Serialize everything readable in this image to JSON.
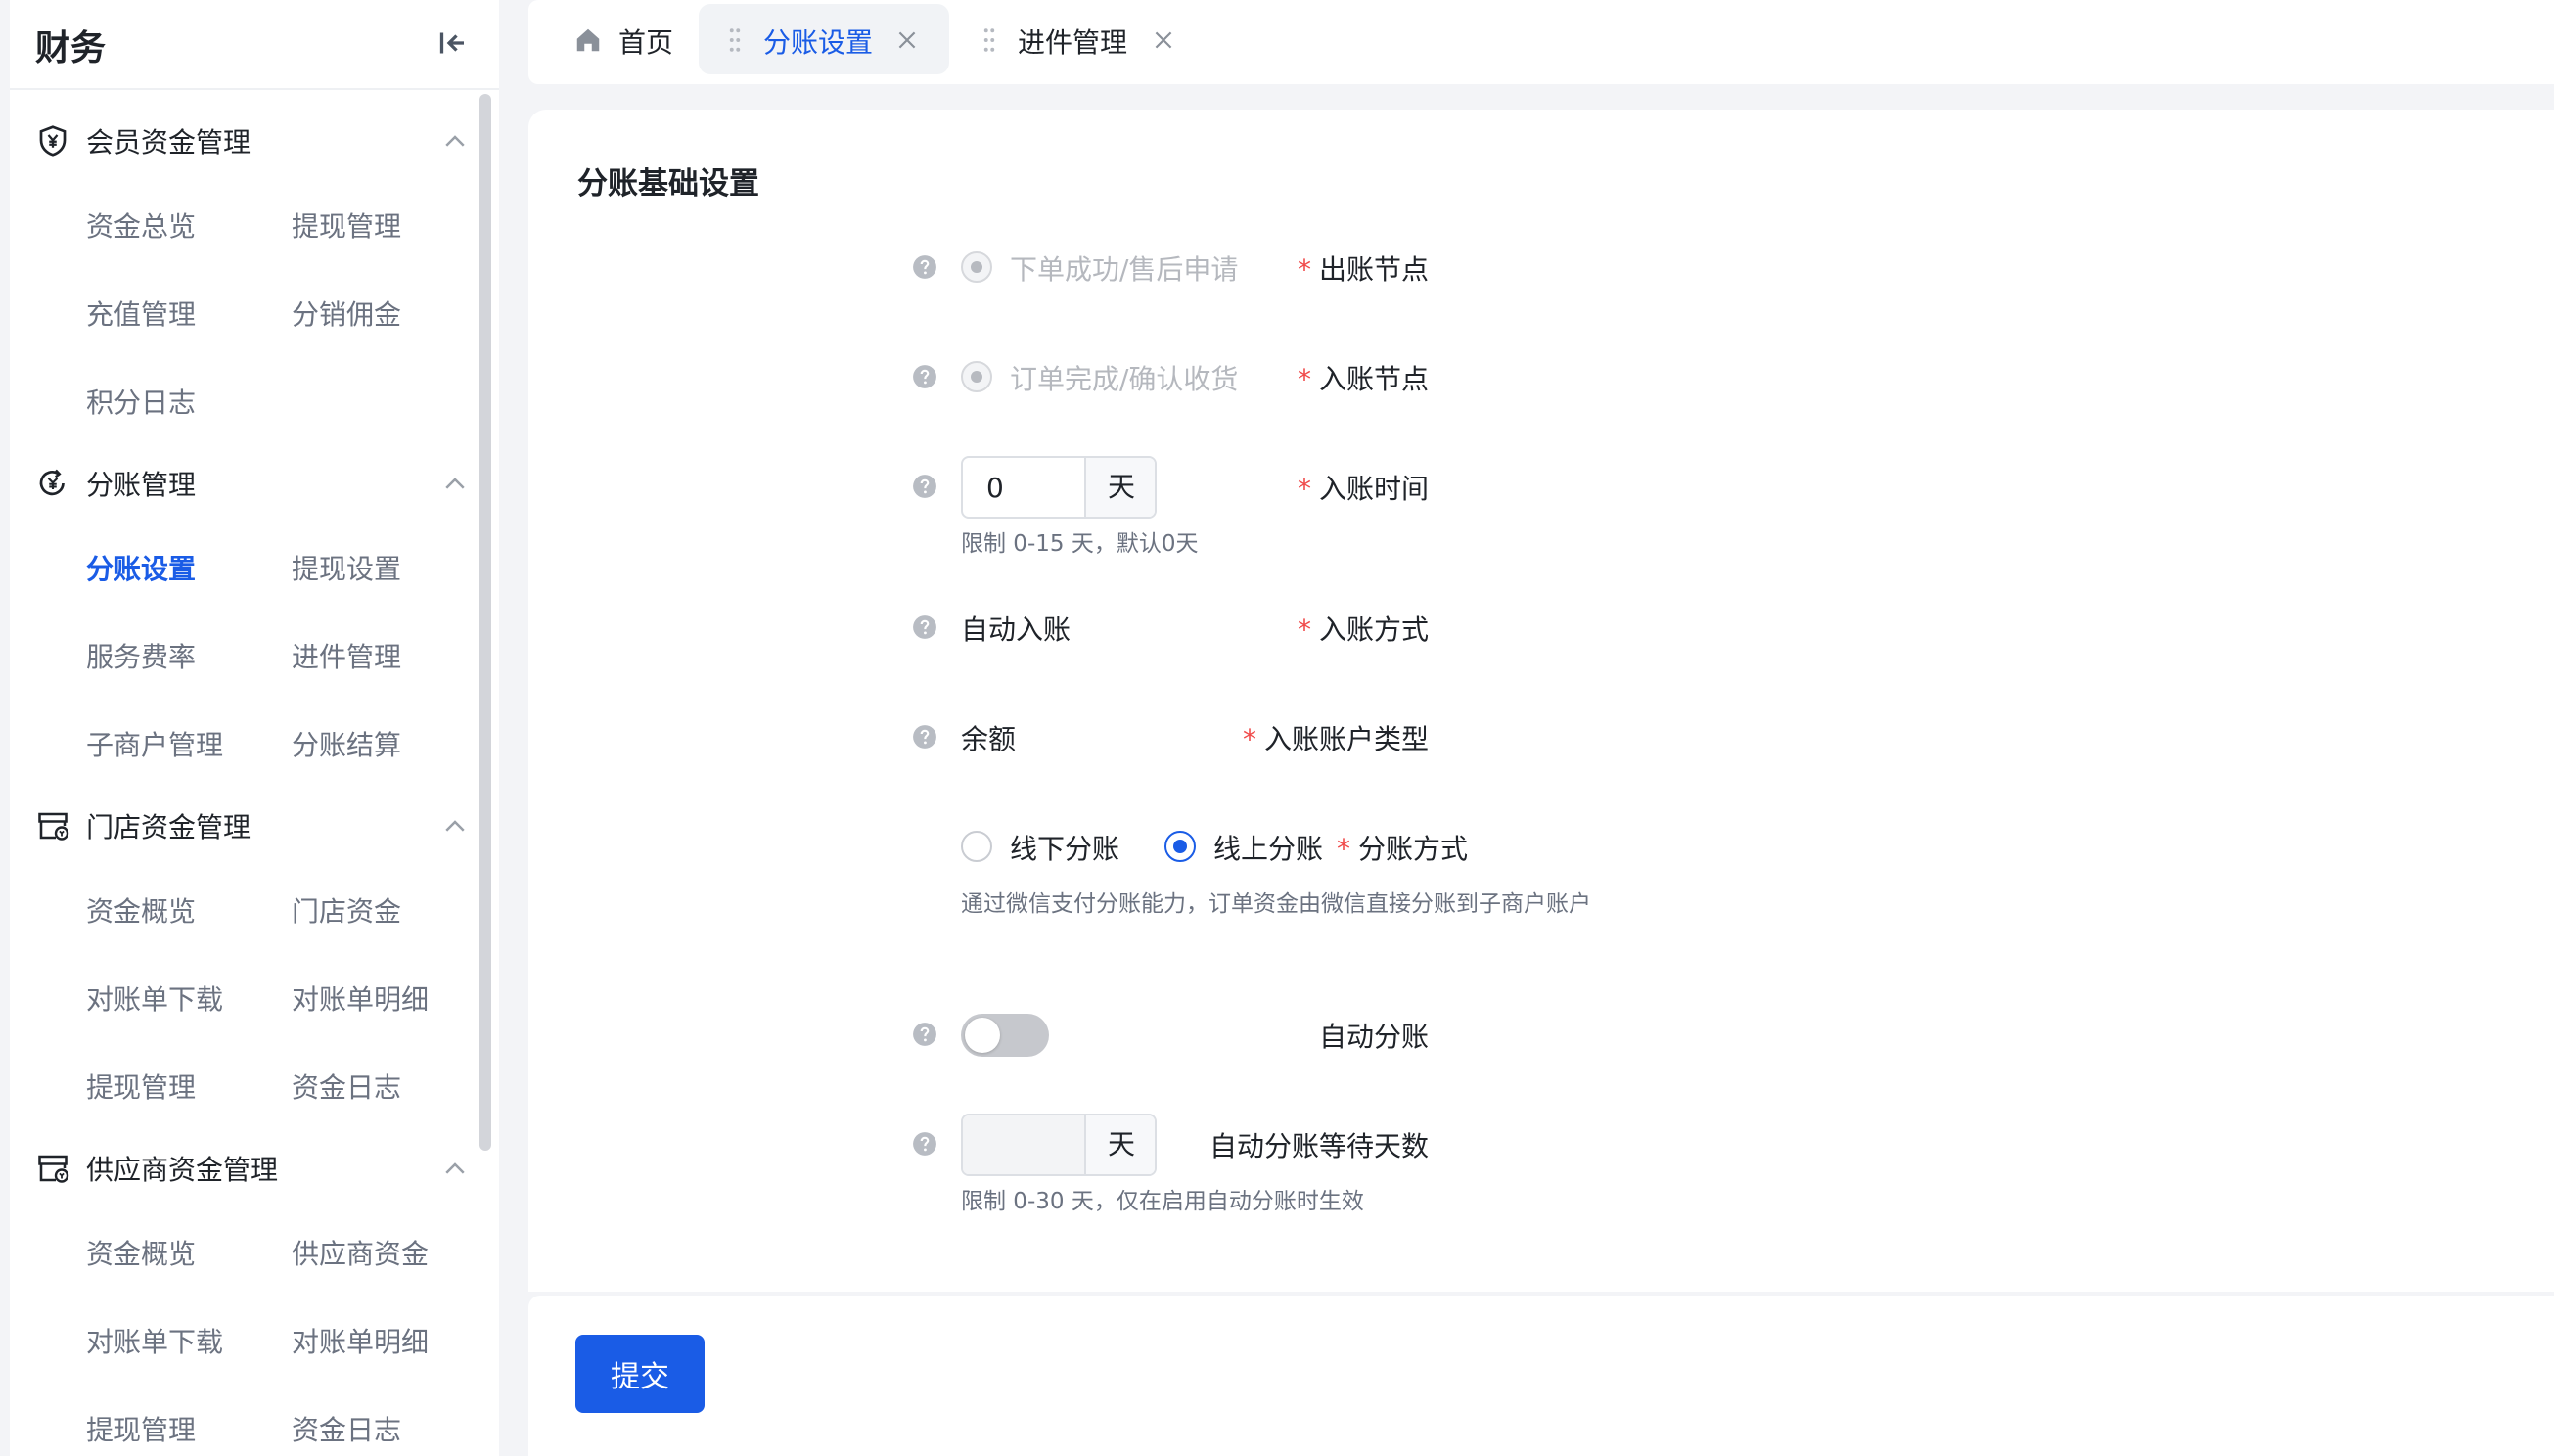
{
  "sidebar": {
    "title": "财务",
    "groups": [
      {
        "label": "会员资金管理",
        "icon": "yuan-shield-icon",
        "items": [
          "资金总览",
          "提现管理",
          "充值管理",
          "分销佣金",
          "积分日志"
        ]
      },
      {
        "label": "分账管理",
        "icon": "yuan-circle-icon",
        "items": [
          "分账设置",
          "提现设置",
          "服务费率",
          "进件管理",
          "子商户管理",
          "分账结算"
        ]
      },
      {
        "label": "门店资金管理",
        "icon": "store-icon",
        "items": [
          "资金概览",
          "门店资金",
          "对账单下载",
          "对账单明细",
          "提现管理",
          "资金日志"
        ]
      },
      {
        "label": "供应商资金管理",
        "icon": "store-icon",
        "items": [
          "资金概览",
          "供应商资金",
          "对账单下载",
          "对账单明细",
          "提现管理",
          "资金日志"
        ]
      }
    ]
  },
  "tabs": [
    {
      "label": "首页",
      "icon": "home-icon"
    },
    {
      "label": "分账设置",
      "active": true
    },
    {
      "label": "进件管理"
    }
  ],
  "form": {
    "section_title": "分账基础设置",
    "billing_node": {
      "label": "出账节点",
      "option": "下单成功/售后申请"
    },
    "entry_node": {
      "label": "入账节点",
      "option": "订单完成/确认收货"
    },
    "entry_time": {
      "label": "入账时间",
      "value": "0",
      "unit": "天",
      "hint": "限制 0-15 天，默认0天"
    },
    "entry_method": {
      "label": "入账方式",
      "value": "自动入账"
    },
    "entry_account_type": {
      "label": "入账账户类型",
      "value": "余额"
    },
    "split_method": {
      "label": "分账方式",
      "options": [
        "线下分账",
        "线上分账"
      ],
      "selected": "线上分账",
      "hint": "通过微信支付分账能力，订单资金由微信直接分账到子商户账户"
    },
    "auto_split": {
      "label": "自动分账",
      "enabled": false
    },
    "auto_split_wait_days": {
      "label": "自动分账等待天数",
      "value": "",
      "unit": "天",
      "hint": "限制 0-30 天，仅在启用自动分账时生效"
    }
  },
  "footer": {
    "submit_label": "提交"
  },
  "colors": {
    "accent": "#1a5ce6",
    "required": "#f04b4b"
  }
}
